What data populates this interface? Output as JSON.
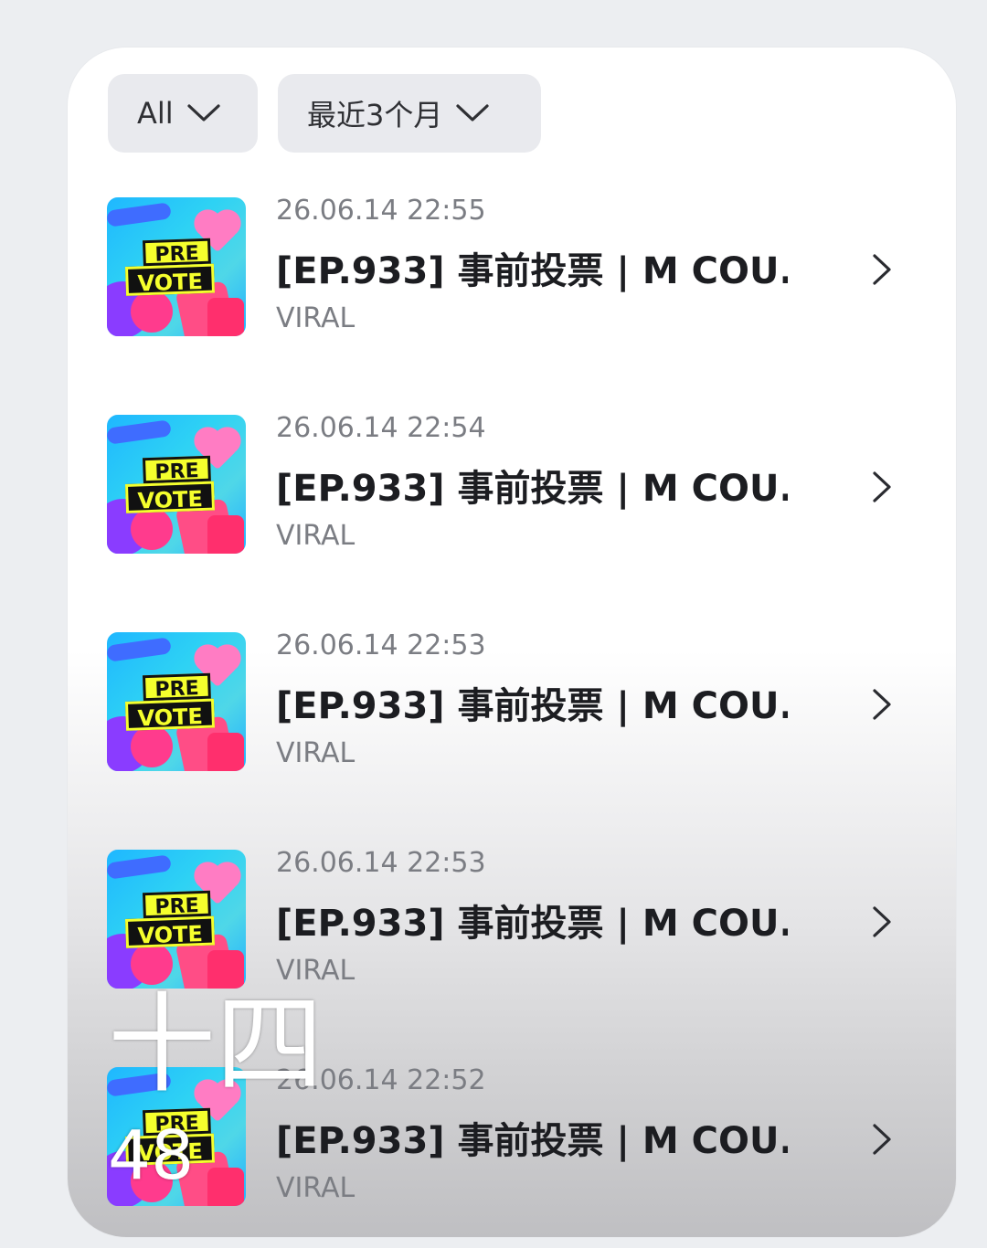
{
  "filters": {
    "type_label": "All",
    "range_label": "最近3个月"
  },
  "items": [
    {
      "time": "26.06.14 22:55",
      "title": "[EP.933] 事前投票 | M COU...",
      "category": "VIRAL",
      "thumb_pre": "PRE",
      "thumb_vote": "VOTE"
    },
    {
      "time": "26.06.14 22:54",
      "title": "[EP.933] 事前投票 | M COU...",
      "category": "VIRAL",
      "thumb_pre": "PRE",
      "thumb_vote": "VOTE"
    },
    {
      "time": "26.06.14 22:53",
      "title": "[EP.933] 事前投票 | M COU...",
      "category": "VIRAL",
      "thumb_pre": "PRE",
      "thumb_vote": "VOTE"
    },
    {
      "time": "26.06.14 22:53",
      "title": "[EP.933] 事前投票 | M COU...",
      "category": "VIRAL",
      "thumb_pre": "PRE",
      "thumb_vote": "VOTE"
    },
    {
      "time": "26.06.14 22:52",
      "title": "[EP.933] 事前投票 | M COU...",
      "category": "VIRAL",
      "thumb_pre": "PRE",
      "thumb_vote": "VOTE"
    }
  ],
  "overlay": {
    "chinese_text": "十四",
    "number": "48"
  }
}
